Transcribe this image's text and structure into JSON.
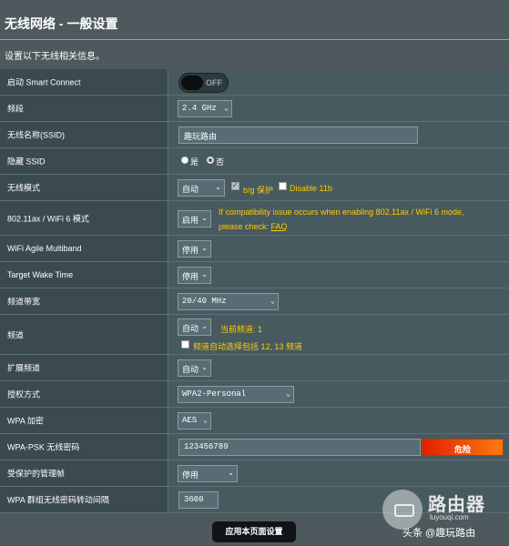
{
  "header": {
    "title": "无线网络 - 一般设置",
    "subtitle": "设置以下无线相关信息。"
  },
  "rows": {
    "smart_connect": {
      "label": "启动 Smart Connect",
      "toggle_text": "OFF",
      "enabled": false
    },
    "band": {
      "label": "频段",
      "value": "2.4 GHz"
    },
    "ssid": {
      "label": "无线名称(SSID)",
      "value": "趣玩路由"
    },
    "hide_ssid": {
      "label": "隐藏 SSID",
      "opt_yes": "是",
      "opt_no": "否",
      "selected": "否"
    },
    "wireless_mode": {
      "label": "无线模式",
      "value": "自动",
      "bg_protect_label": "b/g 保护",
      "bg_protect_checked": true,
      "disable11b_label": "Disable 11b",
      "disable11b_checked": false
    },
    "ax_mode": {
      "label": "802.11ax / WiFi 6 模式",
      "value": "启用",
      "note_line1": "If compatibility issue occurs when enabling 802.11ax / WiFi 6 mode,",
      "note_line2": "please check: ",
      "faq": "FAQ"
    },
    "agile": {
      "label": "WiFi Agile Multiband",
      "value": "停用"
    },
    "twt": {
      "label": "Target Wake Time",
      "value": "停用"
    },
    "bandwidth": {
      "label": "频道带宽",
      "value": "20/40 MHz"
    },
    "channel": {
      "label": "频道",
      "value": "自动",
      "current_label": "当前频道: 1",
      "auto_note": "频道自动选择包括 12, 13 频道",
      "auto_checked": false
    },
    "ext_channel": {
      "label": "扩展频道",
      "value": "自动"
    },
    "auth": {
      "label": "授权方式",
      "value": "WPA2-Personal"
    },
    "wpa_enc": {
      "label": "WPA 加密",
      "value": "AES"
    },
    "psk": {
      "label": "WPA-PSK 无线密码",
      "value": "123456789",
      "strength": "危险"
    },
    "pmf": {
      "label": "受保护的管理帧",
      "value": "停用"
    },
    "gtk": {
      "label": "WPA 群组无线密码转动间隔",
      "value": "3600"
    }
  },
  "apply_button": "应用本页面设置",
  "watermark": {
    "brand": "路由器",
    "url": "luyouqi.com",
    "line": "头条 @趣玩路由"
  },
  "colors": {
    "page_bg": "#4d595d",
    "row_bg": "#475a5f",
    "label_bg": "#3b4a4f",
    "note": "#ffcc00",
    "danger": "#e02000"
  }
}
